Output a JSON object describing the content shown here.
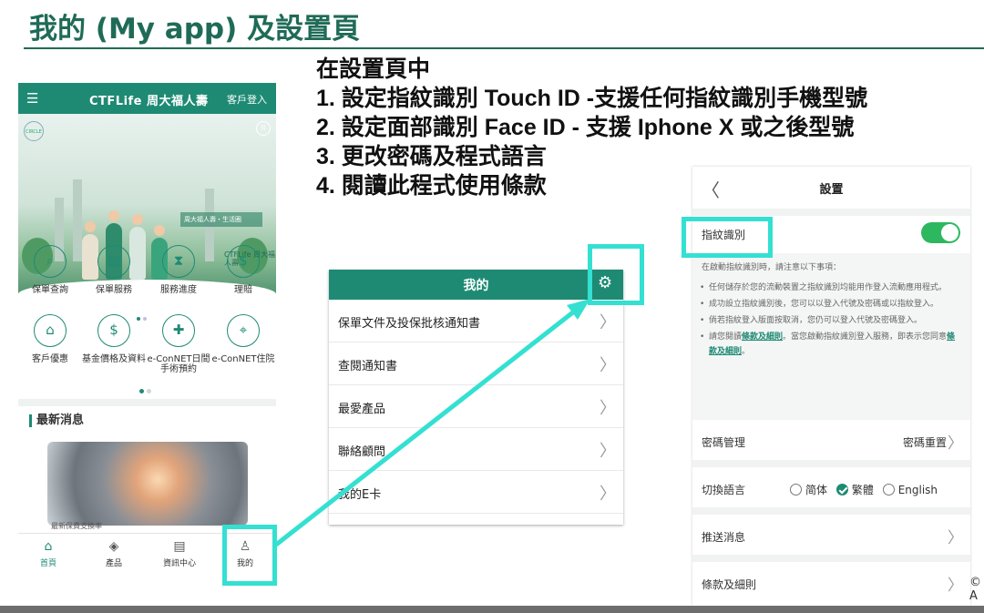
{
  "slide": {
    "title": "我的 (My app) 及設置頁",
    "stray_text": "© A"
  },
  "instructions": {
    "lead": "在設置頁中",
    "steps": [
      "1. 設定指紋識別 Touch ID -支援任何指紋識別手機型號",
      "2. 設定面部識別 Face ID - 支援 Iphone X 或之後型號",
      "3. 更改密碼及程式語言",
      "4. 閱讀此程式使用條款"
    ]
  },
  "home": {
    "brand": "CTFLife 周大福人壽",
    "login": "客戶登入",
    "menu_icon": "☰",
    "banner": {
      "circle_logo": "CIRCLE",
      "pause_icon": "II",
      "caption": "周大福人壽・生活圈",
      "logo": "CTFLife 周大福人壽"
    },
    "services": [
      {
        "label": "保單查詢",
        "icon": "search-icon",
        "glyph": "⌕"
      },
      {
        "label": "保單服務",
        "icon": "document-icon",
        "glyph": "▤"
      },
      {
        "label": "服務進度",
        "icon": "hourglass-icon",
        "glyph": "⧗"
      },
      {
        "label": "理賠",
        "icon": "shield-dollar-icon",
        "glyph": "$"
      },
      {
        "label": "客戶優惠",
        "icon": "gift-icon",
        "glyph": "⌂"
      },
      {
        "label": "基金價格及資料",
        "icon": "dollar-coin-icon",
        "glyph": "$"
      },
      {
        "label": "e-ConNET日間手術預約",
        "icon": "booking-icon",
        "glyph": "✚"
      },
      {
        "label": "e-ConNET住院",
        "icon": "location-pin-icon",
        "glyph": "⌖"
      }
    ],
    "news_title": "最新消息",
    "news_caption": "最新保費支換率",
    "nav": [
      {
        "label": "首頁",
        "icon": "home-icon",
        "glyph": "⌂"
      },
      {
        "label": "產品",
        "icon": "cube-icon",
        "glyph": "◈"
      },
      {
        "label": "資訊中心",
        "icon": "news-icon",
        "glyph": "▤"
      },
      {
        "label": "我的",
        "icon": "user-icon",
        "glyph": "♙"
      }
    ]
  },
  "myapp": {
    "title": "我的",
    "gear_icon": "⚙",
    "items": [
      "保單文件及投保批核通知書",
      "查閱通知書",
      "最愛產品",
      "聯絡顧問",
      "我的E卡"
    ],
    "chevron": "〉"
  },
  "settings": {
    "title": "設置",
    "back_icon": "〈",
    "fingerprint_label": "指紋識別",
    "fingerprint_enabled": true,
    "intro": "在啟動指紋識別時，請注意以下事項：",
    "notes": [
      "任何儲存於您的流動裝置之指紋識別均能用作登入流動應用程式。",
      "成功設立指紋識別後，您可以以登入代號及密碼或以指紋登入。",
      "倘若指紋登入版面按取消，您仍可以登入代號及密碼登入。"
    ],
    "note_last_a": "請您閱讀",
    "note_last_link1": "條款及細則",
    "note_last_b": "。當您啟動指紋識別登入服務，即表示您同意",
    "note_last_link2": "條款及細則",
    "note_last_c": "。",
    "password_label": "密碼管理",
    "password_value": "密碼重置",
    "language_label": "切換語言",
    "languages": [
      "简体",
      "繁體",
      "English"
    ],
    "language_selected": "繁體",
    "push_label": "推送消息",
    "terms_label": "條款及細則",
    "chevron": "〉"
  },
  "colors": {
    "brand_green": "#1e8a74",
    "highlight_cyan": "#34e0d2",
    "toggle_on": "#2db85f",
    "title_green": "#1f6b57"
  }
}
